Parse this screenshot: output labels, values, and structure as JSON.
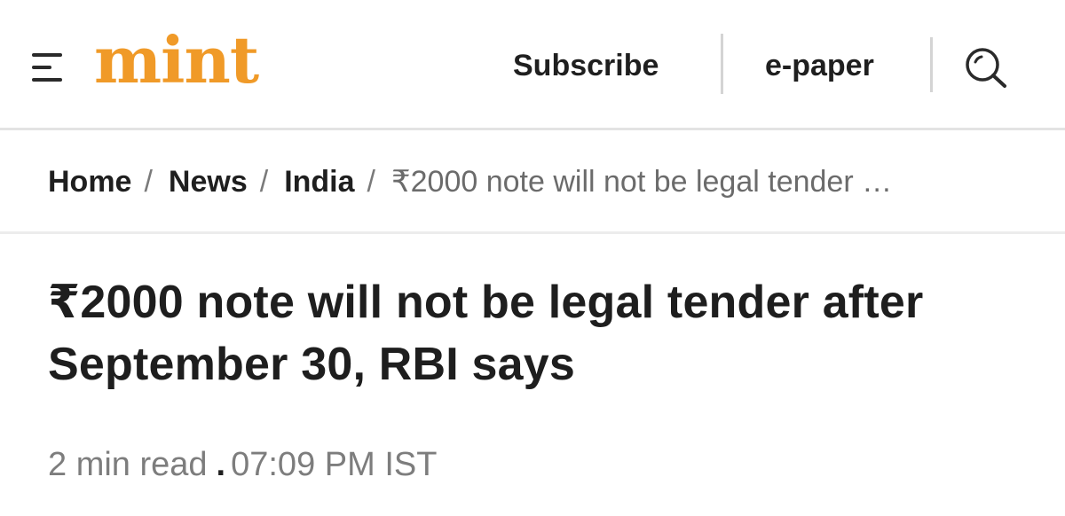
{
  "header": {
    "logo_text": "mint",
    "subscribe_label": "Subscribe",
    "epaper_label": "e-paper",
    "icons": {
      "menu": "hamburger-menu-icon",
      "search": "search-icon"
    },
    "colors": {
      "brand": "#f09a28"
    }
  },
  "breadcrumb": {
    "items": [
      {
        "label": "Home"
      },
      {
        "label": "News"
      },
      {
        "label": "India"
      }
    ],
    "separator": "/",
    "current": "₹2000 note will not be legal tender …"
  },
  "article": {
    "title": "₹2000 note will not be legal tender after September 30, RBI says",
    "read_time": "2 min read",
    "meta_separator": ".",
    "timestamp": "07:09 PM IST"
  }
}
